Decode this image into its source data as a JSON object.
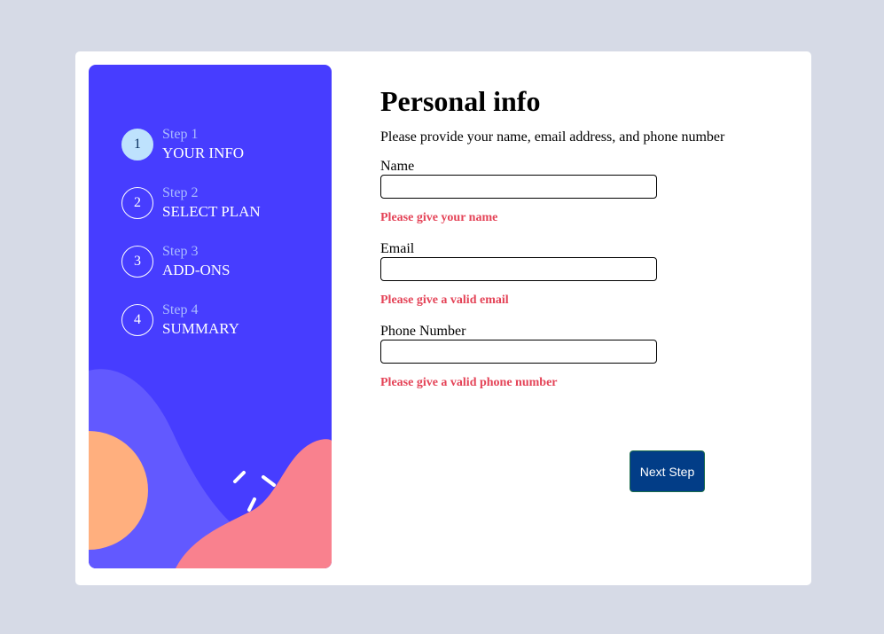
{
  "sidebar": {
    "steps": [
      {
        "number": "1",
        "caption": "Step 1",
        "name": "YOUR INFO",
        "active": true
      },
      {
        "number": "2",
        "caption": "Step 2",
        "name": "SELECT PLAN",
        "active": false
      },
      {
        "number": "3",
        "caption": "Step 3",
        "name": "ADD-ONS",
        "active": false
      },
      {
        "number": "4",
        "caption": "Step 4",
        "name": "SUMMARY",
        "active": false
      }
    ]
  },
  "form": {
    "title": "Personal info",
    "subtitle": "Please provide your name, email address, and phone number",
    "fields": [
      {
        "label": "Name",
        "value": "",
        "error": "Please give your name"
      },
      {
        "label": "Email",
        "value": "",
        "error": "Please give a valid email"
      },
      {
        "label": "Phone Number",
        "value": "",
        "error": "Please give a valid phone number"
      }
    ],
    "next_label": "Next Step"
  },
  "colors": {
    "sidebar_bg": "#473dff",
    "active_step": "#bee2fd",
    "error": "#e44357",
    "button": "#023d87",
    "page_bg": "#d6dae6"
  }
}
